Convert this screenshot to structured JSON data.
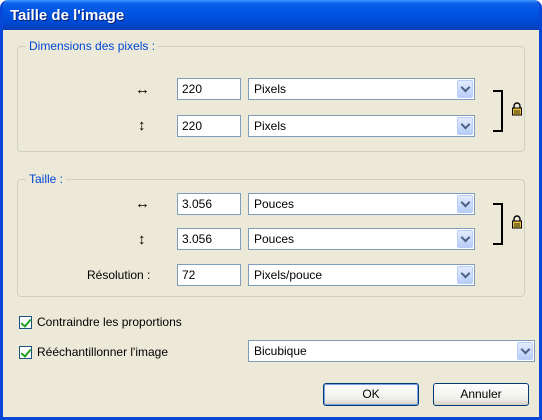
{
  "window": {
    "title": "Taille de l'image"
  },
  "pixel_dimensions": {
    "legend": "Dimensions des pixels :",
    "width_value": "220",
    "width_unit": "Pixels",
    "height_value": "220",
    "height_unit": "Pixels"
  },
  "document_size": {
    "legend": "Taille :",
    "width_value": "3.056",
    "width_unit": "Pouces",
    "height_value": "3.056",
    "height_unit": "Pouces",
    "resolution_label": "Résolution :",
    "resolution_value": "72",
    "resolution_unit": "Pixels/pouce"
  },
  "options": {
    "constrain_label": "Contraindre les proportions",
    "constrain_checked": true,
    "resample_label": "Rééchantillonner l'image",
    "resample_checked": true,
    "resample_method": "Bicubique"
  },
  "buttons": {
    "ok": "OK",
    "cancel": "Annuler"
  },
  "icons": {
    "width_arrow": "↔",
    "height_arrow": "↕"
  }
}
